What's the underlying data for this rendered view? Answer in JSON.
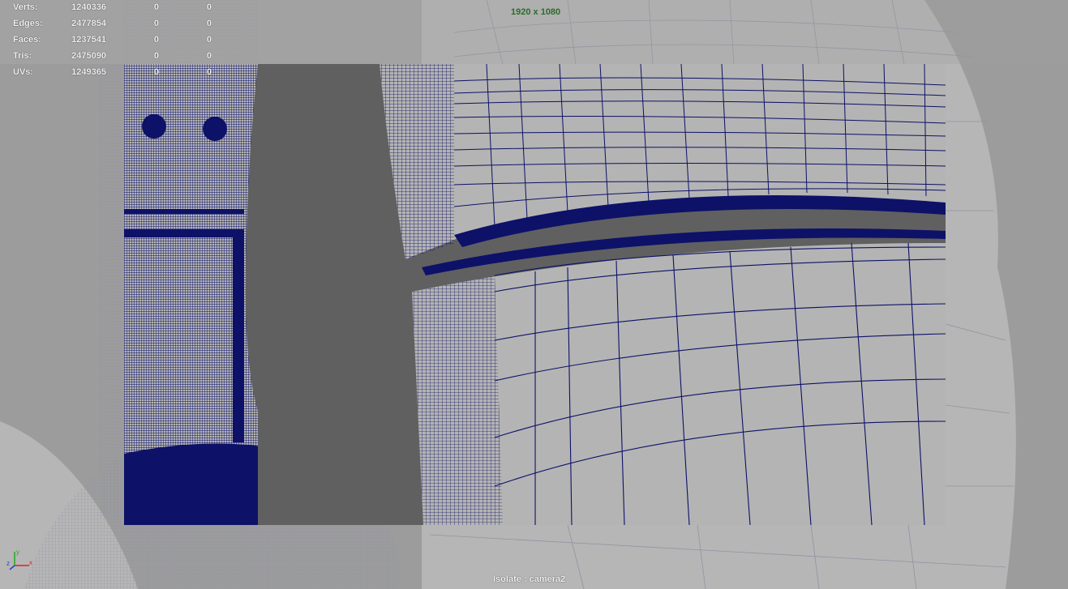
{
  "hud": {
    "rows": [
      {
        "label": "Verts:",
        "total": "1240336",
        "selected": "0",
        "component": "0"
      },
      {
        "label": "Edges:",
        "total": "2477854",
        "selected": "0",
        "component": "0"
      },
      {
        "label": "Faces:",
        "total": "1237541",
        "selected": "0",
        "component": "0"
      },
      {
        "label": "Tris:",
        "total": "2475090",
        "selected": "0",
        "component": "0"
      },
      {
        "label": "UVs:",
        "total": "1249365",
        "selected": "0",
        "component": "0"
      }
    ]
  },
  "resolution_gate": "1920 x 1080",
  "isolate_label": "Isolate : camera2",
  "colors": {
    "background": "#5f5f5f",
    "mesh_fill": "#b4b4b4",
    "mesh_outer": "#9b9b9b",
    "wire_active": "#0d1168",
    "wire_inactive": "#8a8ea6",
    "hud_text": "#f2f2f2",
    "resolution_text": "#2c6b2c"
  },
  "icons": {
    "axis": "xyz-axis-gizmo-icon"
  }
}
